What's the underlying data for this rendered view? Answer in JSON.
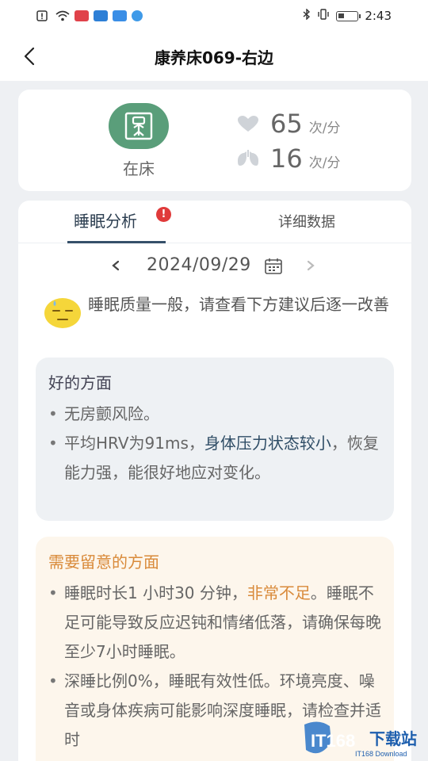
{
  "status_bar": {
    "time": "2:43"
  },
  "nav": {
    "title": "康养床069-右边"
  },
  "bed_status": {
    "label": "在床",
    "heart_rate_value": "65",
    "heart_rate_unit": "次/分",
    "breath_rate_value": "16",
    "breath_rate_unit": "次/分"
  },
  "tabs": {
    "active_label": "睡眠分析",
    "badge": "!",
    "inactive_label": "详细数据"
  },
  "date": {
    "value": "2024/09/29"
  },
  "summary": {
    "text": "睡眠质量一般，请查看下方建议后逐一改善"
  },
  "good": {
    "title": "好的方面",
    "item1": "无房颤风险。",
    "item2_prefix": "平均HRV为91ms，",
    "item2_highlight": "身体压力状态较小",
    "item2_suffix": "，恢复能力强，能很好地应对变化。"
  },
  "warn": {
    "title": "需要留意的方面",
    "item1_prefix": "睡眠时长1 小时30 分钟，",
    "item1_highlight": "非常不足",
    "item1_suffix": "。睡眠不足可能导致反应迟钝和情绪低落，请确保每晚至少7小时睡眠。",
    "item2": "深睡比例0%，睡眠有效性低。环境亮度、噪音或身体疾病可能影响深度睡眠，请检查并适时"
  },
  "watermark": {
    "text": "IT168下载站",
    "sub": "IT168 Download"
  },
  "colors": {
    "bed_green": "#5a9e7a",
    "tab_accent": "#36506a",
    "badge_red": "#e03a3a",
    "warn_orange": "#d98a3a",
    "good_bg": "#eef1f4",
    "warn_bg": "#fdf6ec"
  }
}
